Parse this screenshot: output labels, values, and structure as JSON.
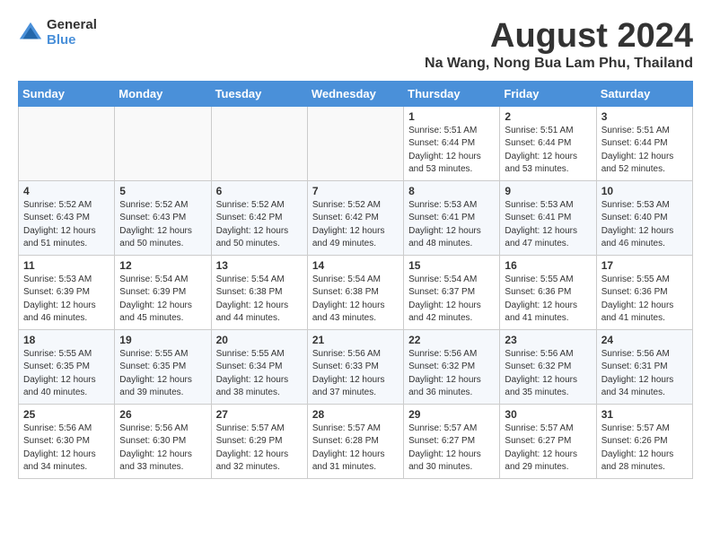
{
  "header": {
    "logo_general": "General",
    "logo_blue": "Blue",
    "month_year": "August 2024",
    "location": "Na Wang, Nong Bua Lam Phu, Thailand"
  },
  "calendar": {
    "days_of_week": [
      "Sunday",
      "Monday",
      "Tuesday",
      "Wednesday",
      "Thursday",
      "Friday",
      "Saturday"
    ],
    "weeks": [
      [
        {
          "day": "",
          "sunrise": "",
          "sunset": "",
          "daylight": ""
        },
        {
          "day": "",
          "sunrise": "",
          "sunset": "",
          "daylight": ""
        },
        {
          "day": "",
          "sunrise": "",
          "sunset": "",
          "daylight": ""
        },
        {
          "day": "",
          "sunrise": "",
          "sunset": "",
          "daylight": ""
        },
        {
          "day": "1",
          "sunrise": "Sunrise: 5:51 AM",
          "sunset": "Sunset: 6:44 PM",
          "daylight": "Daylight: 12 hours and 53 minutes."
        },
        {
          "day": "2",
          "sunrise": "Sunrise: 5:51 AM",
          "sunset": "Sunset: 6:44 PM",
          "daylight": "Daylight: 12 hours and 53 minutes."
        },
        {
          "day": "3",
          "sunrise": "Sunrise: 5:51 AM",
          "sunset": "Sunset: 6:44 PM",
          "daylight": "Daylight: 12 hours and 52 minutes."
        }
      ],
      [
        {
          "day": "4",
          "sunrise": "Sunrise: 5:52 AM",
          "sunset": "Sunset: 6:43 PM",
          "daylight": "Daylight: 12 hours and 51 minutes."
        },
        {
          "day": "5",
          "sunrise": "Sunrise: 5:52 AM",
          "sunset": "Sunset: 6:43 PM",
          "daylight": "Daylight: 12 hours and 50 minutes."
        },
        {
          "day": "6",
          "sunrise": "Sunrise: 5:52 AM",
          "sunset": "Sunset: 6:42 PM",
          "daylight": "Daylight: 12 hours and 50 minutes."
        },
        {
          "day": "7",
          "sunrise": "Sunrise: 5:52 AM",
          "sunset": "Sunset: 6:42 PM",
          "daylight": "Daylight: 12 hours and 49 minutes."
        },
        {
          "day": "8",
          "sunrise": "Sunrise: 5:53 AM",
          "sunset": "Sunset: 6:41 PM",
          "daylight": "Daylight: 12 hours and 48 minutes."
        },
        {
          "day": "9",
          "sunrise": "Sunrise: 5:53 AM",
          "sunset": "Sunset: 6:41 PM",
          "daylight": "Daylight: 12 hours and 47 minutes."
        },
        {
          "day": "10",
          "sunrise": "Sunrise: 5:53 AM",
          "sunset": "Sunset: 6:40 PM",
          "daylight": "Daylight: 12 hours and 46 minutes."
        }
      ],
      [
        {
          "day": "11",
          "sunrise": "Sunrise: 5:53 AM",
          "sunset": "Sunset: 6:39 PM",
          "daylight": "Daylight: 12 hours and 46 minutes."
        },
        {
          "day": "12",
          "sunrise": "Sunrise: 5:54 AM",
          "sunset": "Sunset: 6:39 PM",
          "daylight": "Daylight: 12 hours and 45 minutes."
        },
        {
          "day": "13",
          "sunrise": "Sunrise: 5:54 AM",
          "sunset": "Sunset: 6:38 PM",
          "daylight": "Daylight: 12 hours and 44 minutes."
        },
        {
          "day": "14",
          "sunrise": "Sunrise: 5:54 AM",
          "sunset": "Sunset: 6:38 PM",
          "daylight": "Daylight: 12 hours and 43 minutes."
        },
        {
          "day": "15",
          "sunrise": "Sunrise: 5:54 AM",
          "sunset": "Sunset: 6:37 PM",
          "daylight": "Daylight: 12 hours and 42 minutes."
        },
        {
          "day": "16",
          "sunrise": "Sunrise: 5:55 AM",
          "sunset": "Sunset: 6:36 PM",
          "daylight": "Daylight: 12 hours and 41 minutes."
        },
        {
          "day": "17",
          "sunrise": "Sunrise: 5:55 AM",
          "sunset": "Sunset: 6:36 PM",
          "daylight": "Daylight: 12 hours and 41 minutes."
        }
      ],
      [
        {
          "day": "18",
          "sunrise": "Sunrise: 5:55 AM",
          "sunset": "Sunset: 6:35 PM",
          "daylight": "Daylight: 12 hours and 40 minutes."
        },
        {
          "day": "19",
          "sunrise": "Sunrise: 5:55 AM",
          "sunset": "Sunset: 6:35 PM",
          "daylight": "Daylight: 12 hours and 39 minutes."
        },
        {
          "day": "20",
          "sunrise": "Sunrise: 5:55 AM",
          "sunset": "Sunset: 6:34 PM",
          "daylight": "Daylight: 12 hours and 38 minutes."
        },
        {
          "day": "21",
          "sunrise": "Sunrise: 5:56 AM",
          "sunset": "Sunset: 6:33 PM",
          "daylight": "Daylight: 12 hours and 37 minutes."
        },
        {
          "day": "22",
          "sunrise": "Sunrise: 5:56 AM",
          "sunset": "Sunset: 6:32 PM",
          "daylight": "Daylight: 12 hours and 36 minutes."
        },
        {
          "day": "23",
          "sunrise": "Sunrise: 5:56 AM",
          "sunset": "Sunset: 6:32 PM",
          "daylight": "Daylight: 12 hours and 35 minutes."
        },
        {
          "day": "24",
          "sunrise": "Sunrise: 5:56 AM",
          "sunset": "Sunset: 6:31 PM",
          "daylight": "Daylight: 12 hours and 34 minutes."
        }
      ],
      [
        {
          "day": "25",
          "sunrise": "Sunrise: 5:56 AM",
          "sunset": "Sunset: 6:30 PM",
          "daylight": "Daylight: 12 hours and 34 minutes."
        },
        {
          "day": "26",
          "sunrise": "Sunrise: 5:56 AM",
          "sunset": "Sunset: 6:30 PM",
          "daylight": "Daylight: 12 hours and 33 minutes."
        },
        {
          "day": "27",
          "sunrise": "Sunrise: 5:57 AM",
          "sunset": "Sunset: 6:29 PM",
          "daylight": "Daylight: 12 hours and 32 minutes."
        },
        {
          "day": "28",
          "sunrise": "Sunrise: 5:57 AM",
          "sunset": "Sunset: 6:28 PM",
          "daylight": "Daylight: 12 hours and 31 minutes."
        },
        {
          "day": "29",
          "sunrise": "Sunrise: 5:57 AM",
          "sunset": "Sunset: 6:27 PM",
          "daylight": "Daylight: 12 hours and 30 minutes."
        },
        {
          "day": "30",
          "sunrise": "Sunrise: 5:57 AM",
          "sunset": "Sunset: 6:27 PM",
          "daylight": "Daylight: 12 hours and 29 minutes."
        },
        {
          "day": "31",
          "sunrise": "Sunrise: 5:57 AM",
          "sunset": "Sunset: 6:26 PM",
          "daylight": "Daylight: 12 hours and 28 minutes."
        }
      ]
    ]
  }
}
